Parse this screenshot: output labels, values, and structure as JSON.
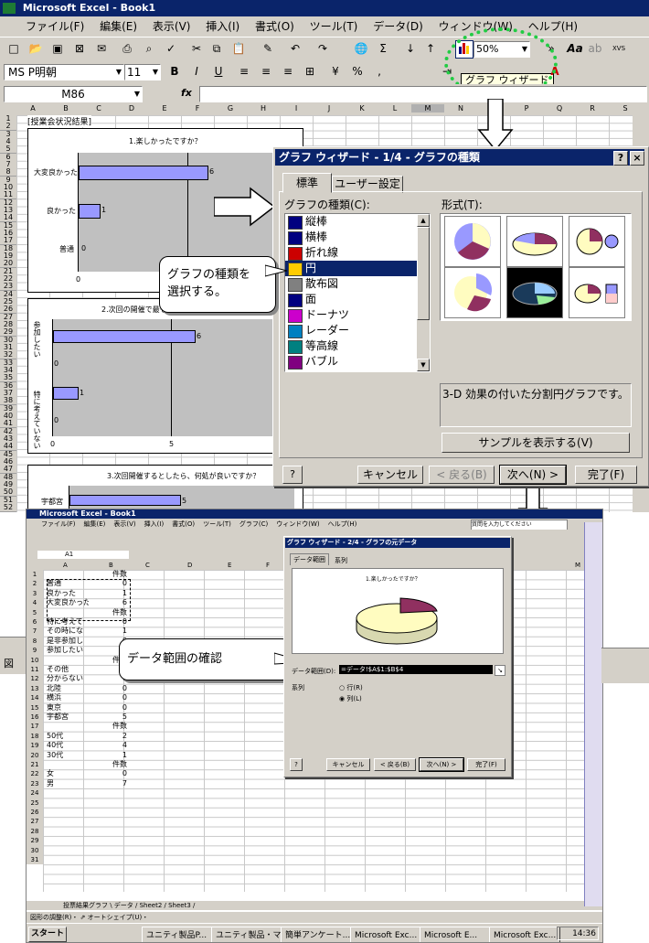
{
  "app": {
    "title": "Microsoft Excel - Book1"
  },
  "menu": [
    "ファイル(F)",
    "編集(E)",
    "表示(V)",
    "挿入(I)",
    "書式(O)",
    "ツール(T)",
    "データ(D)",
    "ウィンドウ(W)",
    "ヘルプ(H)"
  ],
  "toolbar": {
    "zoom": "50%",
    "font": "MS P明朝",
    "size": "11",
    "tooltip": "グラフ ウィザード"
  },
  "formula": {
    "namebox": "M86",
    "fx": "fx"
  },
  "columns": [
    "A",
    "B",
    "C",
    "D",
    "E",
    "F",
    "G",
    "H",
    "I",
    "J",
    "K",
    "L",
    "M",
    "N",
    "O",
    "P",
    "Q",
    "R",
    "S"
  ],
  "sheet": {
    "heading": "[授業会状況結果]",
    "chart1": {
      "title": "1.楽しかったですか？",
      "labels": [
        "大変良かった",
        "良かった",
        "普通"
      ],
      "values": [
        6,
        1,
        0
      ],
      "axis0": "0"
    },
    "chart2": {
      "title": "2.次回の開催で最もよ...",
      "labels": [
        "参加したい",
        "特に考えていない"
      ],
      "values": [
        6,
        0,
        1,
        0
      ],
      "axis": [
        "0",
        "5"
      ]
    },
    "chart3": {
      "title": "3.次回開催するとしたら、何処が良いですか？",
      "labels": [
        "宇都宮"
      ],
      "values": [
        5
      ]
    }
  },
  "dialog1": {
    "title": "グラフ ウィザード - 1/4 - グラフの種類",
    "help": "?",
    "close": "×",
    "tab_standard": "標準",
    "tab_user": "ユーザー設定",
    "types_label": "グラフの種類(C):",
    "format_label": "形式(T):",
    "types": [
      "縦棒",
      "横棒",
      "折れ線",
      "円",
      "散布図",
      "面",
      "ドーナツ",
      "レーダー",
      "等高線",
      "バブル"
    ],
    "selected_index": 3,
    "description": "3-D 効果の付いた分割円グラフです。",
    "sample_btn": "サンプルを表示する(V)",
    "cancel": "キャンセル",
    "back": "< 戻る(B)",
    "next": "次へ(N) >",
    "finish": "完了(F)"
  },
  "callouts": {
    "type_select": "グラフの種類を\n選択する。",
    "range_check": "データ範囲の確認"
  },
  "screen2": {
    "title": "Microsoft Excel - Book1",
    "menu": [
      "ファイル(F)",
      "編集(E)",
      "表示(V)",
      "挿入(I)",
      "書式(O)",
      "ツール(T)",
      "グラフ(C)",
      "ウィンドウ(W)",
      "ヘルプ(H)"
    ],
    "namebox": "A1",
    "search": "質問を入力してください",
    "rows": [
      {
        "n": "1",
        "a": "",
        "b": "件数"
      },
      {
        "n": "2",
        "a": "普通",
        "b": "0"
      },
      {
        "n": "3",
        "a": "良かった",
        "b": "1"
      },
      {
        "n": "4",
        "a": "大変良かった",
        "b": "6"
      },
      {
        "n": "5",
        "a": "",
        "b": "件数"
      },
      {
        "n": "6",
        "a": "特に考えて",
        "b": "0"
      },
      {
        "n": "7",
        "a": "その時にな",
        "b": "1"
      },
      {
        "n": "8",
        "a": "是非参加し",
        "b": "0"
      },
      {
        "n": "9",
        "a": "参加したい",
        "b": "6"
      },
      {
        "n": "10",
        "a": "",
        "b": "件数"
      },
      {
        "n": "11",
        "a": "その他",
        "b": "0"
      },
      {
        "n": "12",
        "a": "分からない",
        "b": "1"
      },
      {
        "n": "13",
        "a": "北陸",
        "b": "0"
      },
      {
        "n": "14",
        "a": "横浜",
        "b": "0"
      },
      {
        "n": "15",
        "a": "東京",
        "b": "0"
      },
      {
        "n": "16",
        "a": "宇都宮",
        "b": "5"
      },
      {
        "n": "17",
        "a": "",
        "b": "件数"
      },
      {
        "n": "18",
        "a": "50代",
        "b": "2"
      },
      {
        "n": "19",
        "a": "40代",
        "b": "4"
      },
      {
        "n": "20",
        "a": "30代",
        "b": "1"
      },
      {
        "n": "21",
        "a": "",
        "b": "件数"
      },
      {
        "n": "22",
        "a": "女",
        "b": "0"
      },
      {
        "n": "23",
        "a": "男",
        "b": "7"
      },
      {
        "n": "24",
        "a": "",
        "b": ""
      },
      {
        "n": "25",
        "a": "",
        "b": ""
      },
      {
        "n": "26",
        "a": "",
        "b": ""
      },
      {
        "n": "27",
        "a": "",
        "b": ""
      },
      {
        "n": "28",
        "a": "",
        "b": ""
      },
      {
        "n": "29",
        "a": "",
        "b": ""
      },
      {
        "n": "30",
        "a": "",
        "b": ""
      },
      {
        "n": "31",
        "a": "",
        "b": ""
      }
    ],
    "tabs": "投票結果グラフ \\ データ / Sheet2 / Sheet3 /",
    "draw_bar": "図形の調整(R)・ ⇗ オートシェイプ(U)・",
    "start": "スタート",
    "tasks": [
      "ユニティ製品P...",
      "ユニティ製品・マ...",
      "簡単アンケート...",
      "Microsoft Exc...",
      "Microsoft E...",
      "Microsoft Exc..."
    ],
    "clock": "14:36"
  },
  "dialog2": {
    "title": "グラフ ウィザード - 2/4 - グラフの元データ",
    "tab_range": "データ範囲",
    "tab_series": "系列",
    "chart_title": "1.楽しかったですか？",
    "range_label": "データ範囲(D):",
    "range_value": "=データ!$A$1:$B$4",
    "series_label": "系列",
    "row": "行(R)",
    "col": "列(L)",
    "cancel": "キャンセル",
    "back": "< 戻る(B)",
    "next": "次へ(N) >",
    "finish": "完了(F)"
  },
  "colors": {
    "title_bar": "#0a246a",
    "face": "#d4d0c8",
    "bar": "#9999ff",
    "highlight": "#00cc44"
  }
}
